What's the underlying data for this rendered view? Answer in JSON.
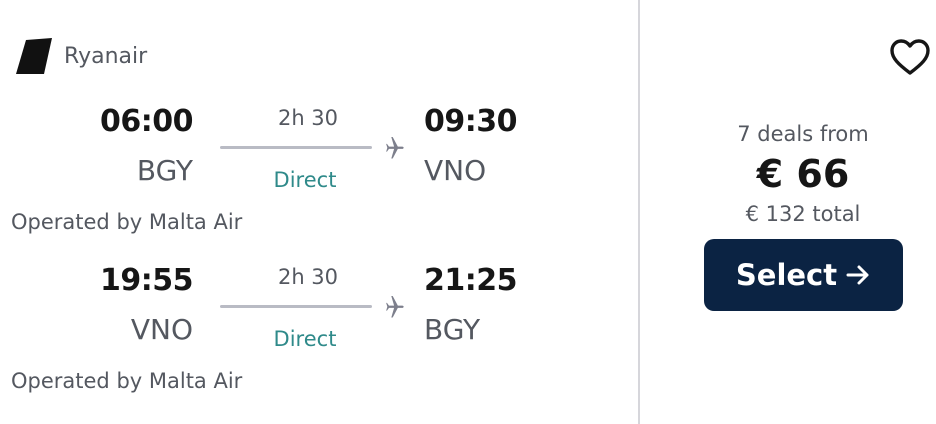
{
  "airline": {
    "name": "Ryanair",
    "logo_icon": "ryanair-tail-logo"
  },
  "legs": [
    {
      "departure_time": "06:00",
      "departure_code": "BGY",
      "duration": "2h 30",
      "stops": "Direct",
      "arrival_time": "09:30",
      "arrival_code": "VNO",
      "operated_by": "Operated by Malta Air"
    },
    {
      "departure_time": "19:55",
      "departure_code": "VNO",
      "duration": "2h 30",
      "stops": "Direct",
      "arrival_time": "21:25",
      "arrival_code": "BGY",
      "operated_by": "Operated by Malta Air"
    }
  ],
  "pricing": {
    "deals_text": "7 deals from",
    "price": "€ 66",
    "total": "€ 132 total",
    "select_label": "Select",
    "select_icon": "arrow-right-icon",
    "favorite_icon": "heart-icon"
  },
  "colors": {
    "select_button": "#0b2343",
    "direct_text": "#2f8a8a",
    "divider": "#d6d6db"
  }
}
